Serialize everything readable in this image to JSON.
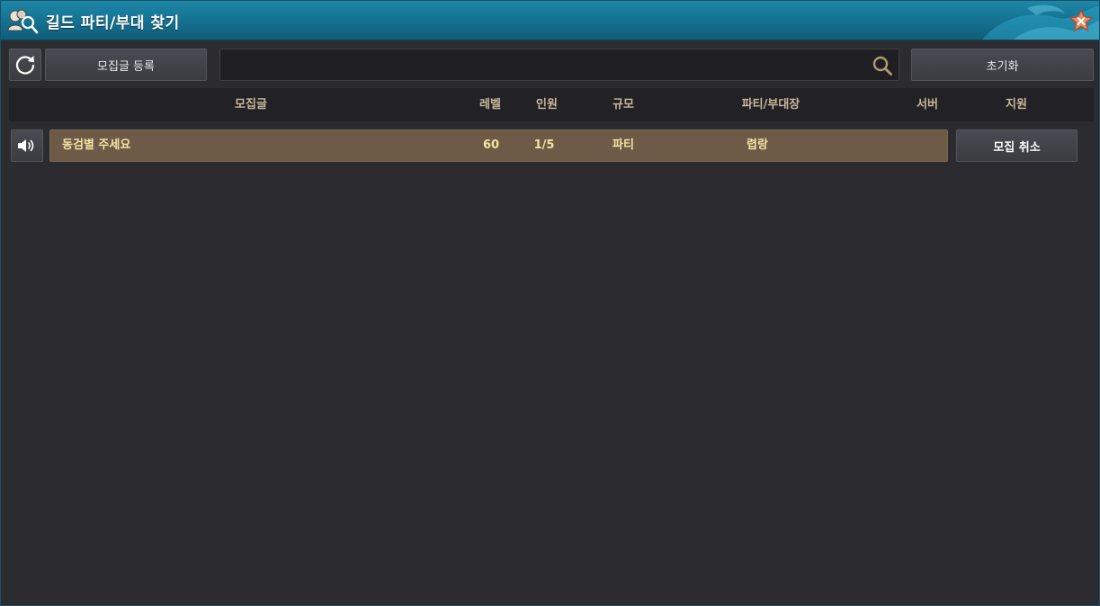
{
  "window": {
    "title": "길드 파티/부대 찾기",
    "accent": "#1a7fa0"
  },
  "toolbar": {
    "refresh_icon": "refresh-icon",
    "register_label": "모집글 등록",
    "search_value": "",
    "search_placeholder": "",
    "search_icon": "search-icon",
    "reset_label": "초기화"
  },
  "table": {
    "columns": {
      "post": "모집글",
      "level": "레벨",
      "members": "인원",
      "size": "규모",
      "leader": "파티/부대장",
      "server": "서버",
      "apply": "지원"
    },
    "rows": [
      {
        "post": "동검별 주세요",
        "level": "60",
        "members": "1/5",
        "size": "파티",
        "leader": "렵랑",
        "server": "",
        "action_label": "모집 취소",
        "highlight": "#6d5a47"
      }
    ]
  }
}
